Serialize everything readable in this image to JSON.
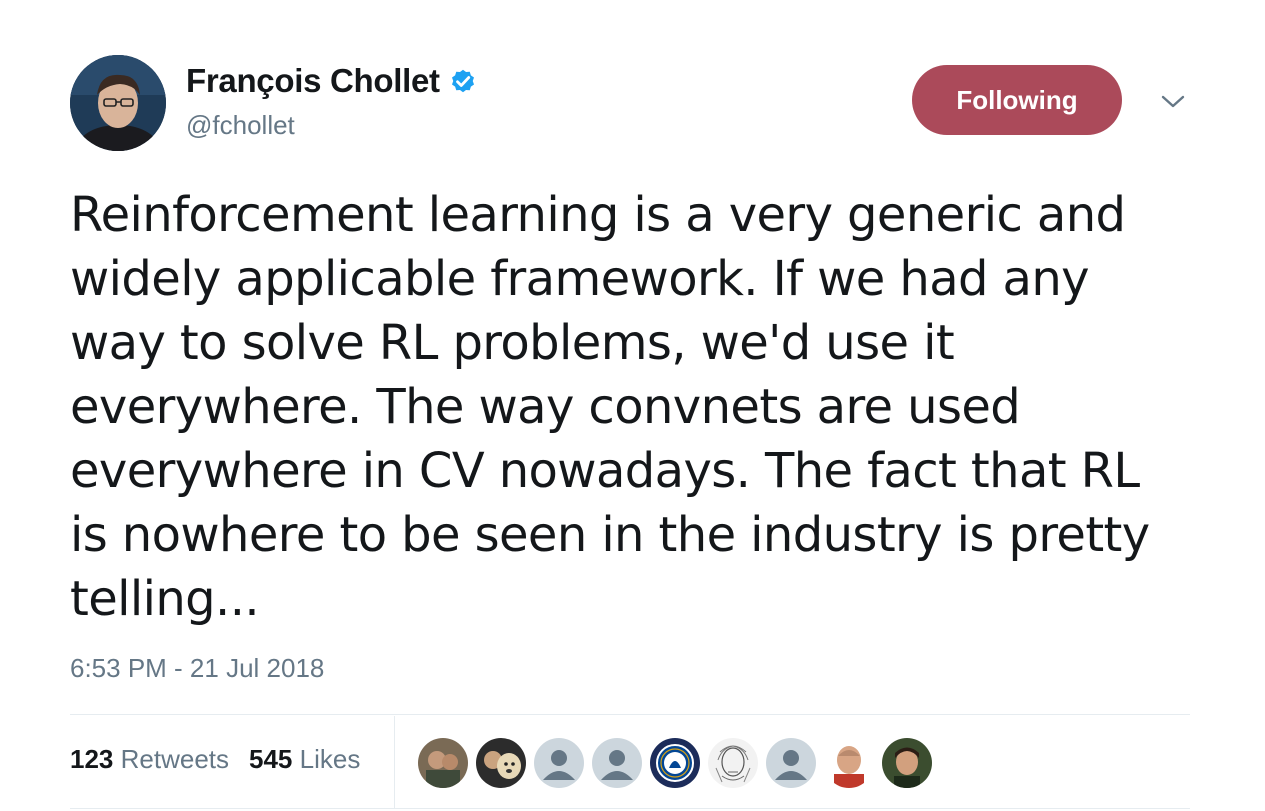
{
  "author": {
    "name": "François Chollet",
    "handle": "@fchollet",
    "verified": true
  },
  "follow_button": {
    "label": "Following",
    "color": "#ab4a5a"
  },
  "tweet": {
    "text": "Reinforcement learning is a very generic and\nwidely applicable framework. If we had any\nway to solve RL problems, we'd use it\neverywhere. The way convnets are used\neverywhere in CV nowadays. The fact that RL\nis nowhere to be seen in the industry is pretty\ntelling...",
    "timestamp": "6:53 PM - 21 Jul 2018"
  },
  "stats": {
    "retweets_count": "123",
    "retweets_label": "Retweets",
    "likes_count": "545",
    "likes_label": "Likes"
  },
  "likers": [
    {
      "icon": "user-photo-icon"
    },
    {
      "icon": "dog-photo-icon"
    },
    {
      "icon": "default-avatar-icon"
    },
    {
      "icon": "default-avatar-icon"
    },
    {
      "icon": "chelsea-crest-icon"
    },
    {
      "icon": "sketch-portrait-icon"
    },
    {
      "icon": "default-avatar-icon"
    },
    {
      "icon": "user-photo-icon"
    },
    {
      "icon": "user-photo-icon"
    }
  ],
  "colors": {
    "text": "#14171a",
    "secondary": "#657786",
    "verified": "#1da1f2",
    "divider": "#e6ecf0"
  }
}
